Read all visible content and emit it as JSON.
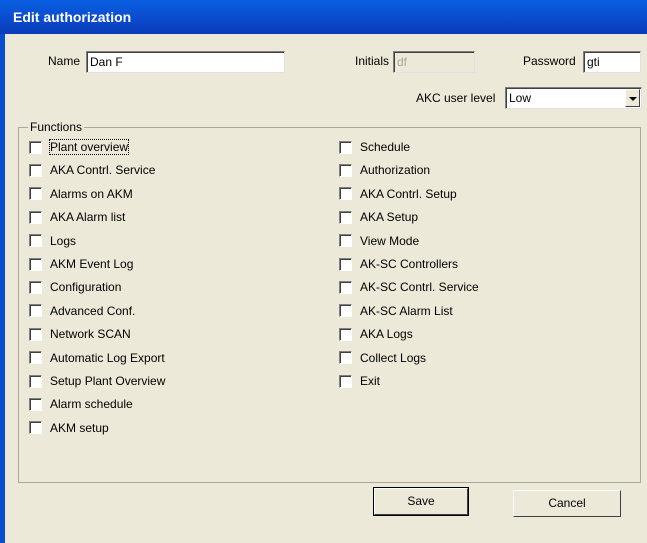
{
  "window": {
    "title": "Edit authorization"
  },
  "form": {
    "name_label": "Name",
    "name_value": "Dan F",
    "initials_label": "Initials",
    "initials_value": "df",
    "password_label": "Password",
    "password_value": "gti",
    "user_level_label": "AKC user level",
    "user_level_value": "Low"
  },
  "functions": {
    "title": "Functions",
    "left": [
      "Plant overview",
      "AKA Contrl. Service",
      "Alarms on AKM",
      "AKA Alarm list",
      "Logs",
      "AKM Event Log",
      "Configuration",
      "Advanced Conf.",
      "Network SCAN",
      "Automatic Log Export",
      "Setup Plant Overview",
      "Alarm schedule",
      "AKM setup"
    ],
    "right": [
      "Schedule",
      "Authorization",
      "AKA Contrl. Setup",
      "AKA Setup",
      "View Mode",
      "AK-SC Controllers",
      "AK-SC Contrl. Service",
      "AK-SC Alarm List",
      "AKA Logs",
      "Collect Logs",
      "Exit"
    ]
  },
  "buttons": {
    "save": "Save",
    "cancel": "Cancel"
  }
}
